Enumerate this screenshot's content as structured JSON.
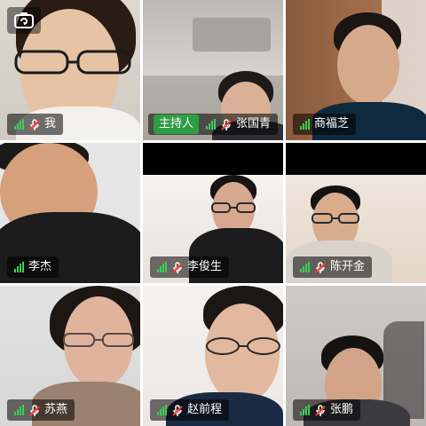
{
  "tiles": [
    {
      "name": "我",
      "host": false,
      "colors": {
        "bg": "#d9d6cf",
        "skin": "#e7c3a6",
        "hair": "#2a1c14",
        "shirt": "#f3f1ee"
      }
    },
    {
      "name": "张国青",
      "host": true,
      "host_label": "主持人",
      "colors": {
        "bg": "#b7b3ae",
        "skin": "#d8b197",
        "hair": "#1f1a17",
        "shirt": "#2f2f33"
      }
    },
    {
      "name": "商福芝",
      "host": false,
      "colors": {
        "bg": "#8a5a3c",
        "skin": "#d7a98b",
        "hair": "#1b1513",
        "shirt": "#0f2a3f"
      }
    },
    {
      "name": "李杰",
      "host": false,
      "colors": {
        "bg": "#e5e5e5",
        "skin": "#d7a07c",
        "hair": "#1c1a19",
        "shirt": "#1c1c1c"
      }
    },
    {
      "name": "李俊生",
      "host": false,
      "colors": {
        "bg": "#f0ece9",
        "skin": "#d6a98e",
        "hair": "#171414",
        "shirt": "#1c1c1c"
      }
    },
    {
      "name": "陈开金",
      "host": false,
      "colors": {
        "bg": "#e9ded3",
        "skin": "#d9ac8e",
        "hair": "#151312",
        "shirt": "#d9d3cb"
      }
    },
    {
      "name": "苏燕",
      "host": false,
      "colors": {
        "bg": "#dedede",
        "skin": "#e0b39d",
        "hair": "#1d1714",
        "shirt": "#9b8270"
      }
    },
    {
      "name": "赵前程",
      "host": false,
      "colors": {
        "bg": "#f2efee",
        "skin": "#e2b89e",
        "hair": "#1a1716",
        "shirt": "#1b2a44"
      }
    },
    {
      "name": "张鹏",
      "host": false,
      "colors": {
        "bg": "#c9c7c4",
        "skin": "#d2a386",
        "hair": "#141312",
        "shirt": "#3b3b3f"
      }
    }
  ],
  "icons": {
    "camera_switch": "camera-switch-icon",
    "signal": "signal-strength-icon",
    "mic_muted": "mic-muted-icon"
  },
  "accent": {
    "active_border": "#4caf50",
    "signal": "#37d152",
    "host_badge": "#2e9e44"
  }
}
